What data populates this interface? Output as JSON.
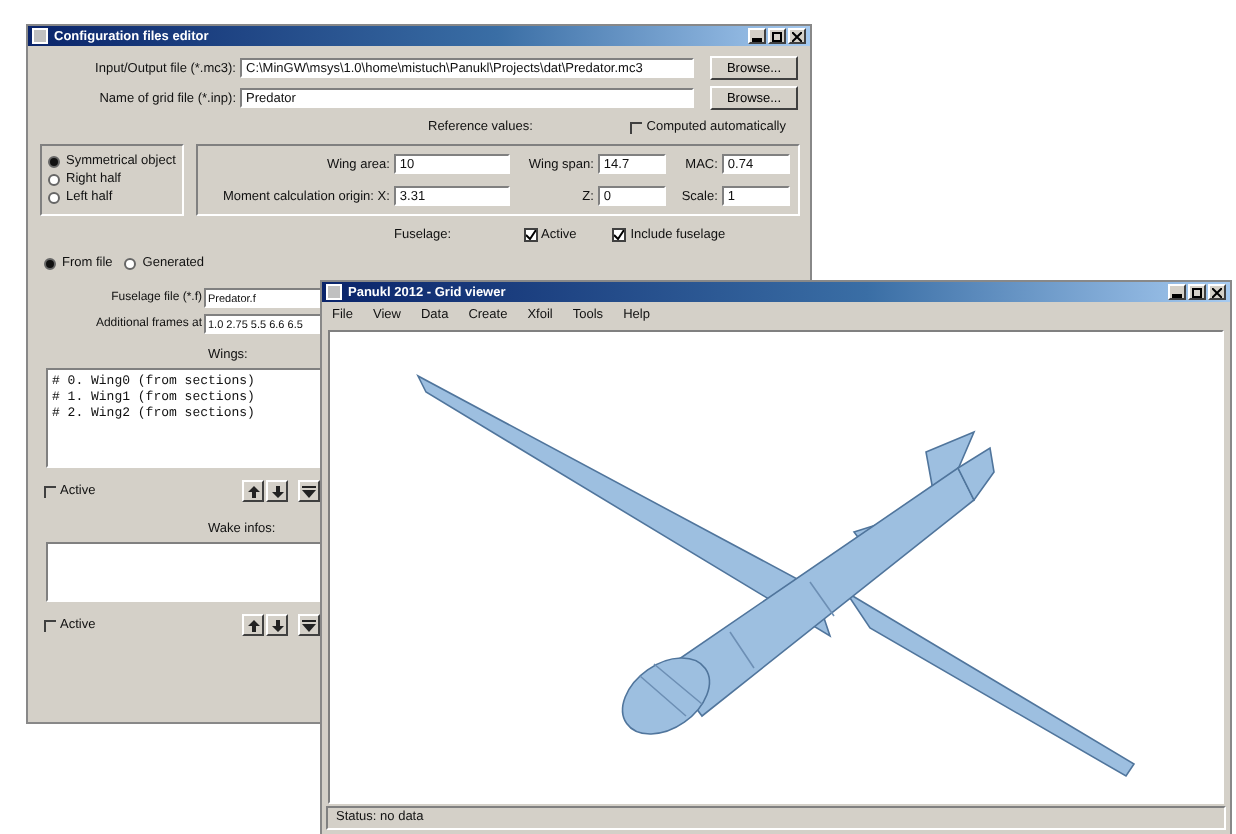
{
  "config_window": {
    "title": "Configuration files editor",
    "files": [
      {
        "label": "Input/Output file (*.mc3):",
        "value": "C:\\MinGW\\msys\\1.0\\home\\mistuch\\Panukl\\Projects\\dat\\Predator.mc3",
        "button": "Browse..."
      },
      {
        "label": "Name of grid file (*.inp):",
        "value": "Predator",
        "button": "Browse..."
      }
    ],
    "reference_values": {
      "title": "Reference values:",
      "computed_automatically": {
        "label": "Computed automatically",
        "checked": false
      },
      "wing_area": {
        "label": "Wing area:",
        "value": "10"
      },
      "wing_span": {
        "label": "Wing span:",
        "value": "14.7"
      },
      "mac": {
        "label": "MAC:",
        "value": "0.74"
      },
      "origin_x": {
        "label": "Moment calculation origin:  X:",
        "value": "3.31"
      },
      "origin_z": {
        "label": "Z:",
        "value": "0"
      },
      "scale": {
        "label": "Scale:",
        "value": "1"
      }
    },
    "symmetry": [
      {
        "label": "Symmetrical object",
        "selected": true
      },
      {
        "label": "Right half",
        "selected": false
      },
      {
        "label": "Left half",
        "selected": false
      }
    ],
    "fuselage": {
      "title": "Fuselage:",
      "active": {
        "label": "Active",
        "checked": true
      },
      "include": {
        "label": "Include fuselage",
        "checked": true
      },
      "source": [
        {
          "label": "From file",
          "selected": true
        },
        {
          "label": "Generated",
          "selected": false
        }
      ],
      "file": {
        "label": "Fuselage file (*.f)",
        "value": "Predator.f"
      },
      "frames": {
        "label": "Additional frames at",
        "value": "1.0 2.75 5.5 6.6 6.5"
      }
    },
    "wings": {
      "title": "Wings:",
      "items": [
        "# 0. Wing0 (from sections)",
        "# 1. Wing1 (from sections)",
        "# 2. Wing2 (from sections)"
      ],
      "active": {
        "label": "Active",
        "checked": false
      }
    },
    "wake_infos": {
      "title": "Wake infos:",
      "active": {
        "label": "Active",
        "checked": false
      }
    }
  },
  "grid_viewer": {
    "title": "Panukl 2012 - Grid viewer",
    "menu": [
      "File",
      "View",
      "Data",
      "Create",
      "Xfoil",
      "Tools",
      "Help"
    ],
    "status_bar": "Status: no data"
  }
}
